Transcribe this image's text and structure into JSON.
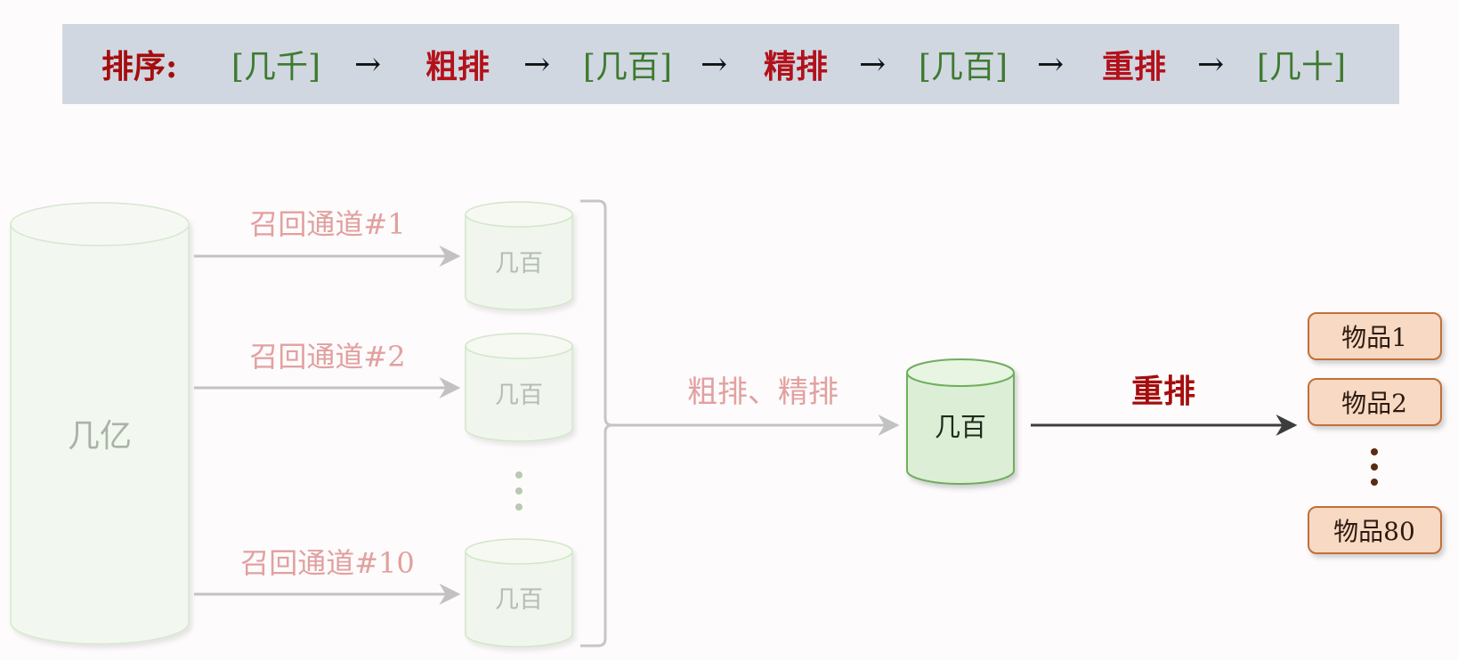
{
  "banner": {
    "label": "排序:",
    "flow": [
      {
        "kind": "count",
        "text": "[几千]"
      },
      {
        "kind": "stage",
        "text": "粗排"
      },
      {
        "kind": "count",
        "text": "[几百]"
      },
      {
        "kind": "stage",
        "text": "精排"
      },
      {
        "kind": "count",
        "text": "[几百]"
      },
      {
        "kind": "stage",
        "text": "重排"
      },
      {
        "kind": "count",
        "text": "[几十]"
      }
    ],
    "arrow": "→"
  },
  "diagram": {
    "source_db": "几亿",
    "channels": [
      {
        "label": "召回通道#1",
        "db": "几百"
      },
      {
        "label": "召回通道#2",
        "db": "几百"
      },
      {
        "label": "召回通道#10",
        "db": "几百"
      }
    ],
    "ranking_label": "粗排、精排",
    "merged_db": "几百",
    "rerank_label": "重排",
    "items": [
      "物品1",
      "物品2",
      "物品80"
    ]
  },
  "colors": {
    "banner_bg": "#d0d7e1",
    "stage_red": "#b3111a",
    "count_green": "#3e7a2f",
    "faded_pink": "#e2a0a0",
    "db_green_fill": "#dcefd6",
    "db_green_stroke": "#6fae5f",
    "item_fill": "#f8d9c3",
    "item_stroke": "#c0703a"
  }
}
